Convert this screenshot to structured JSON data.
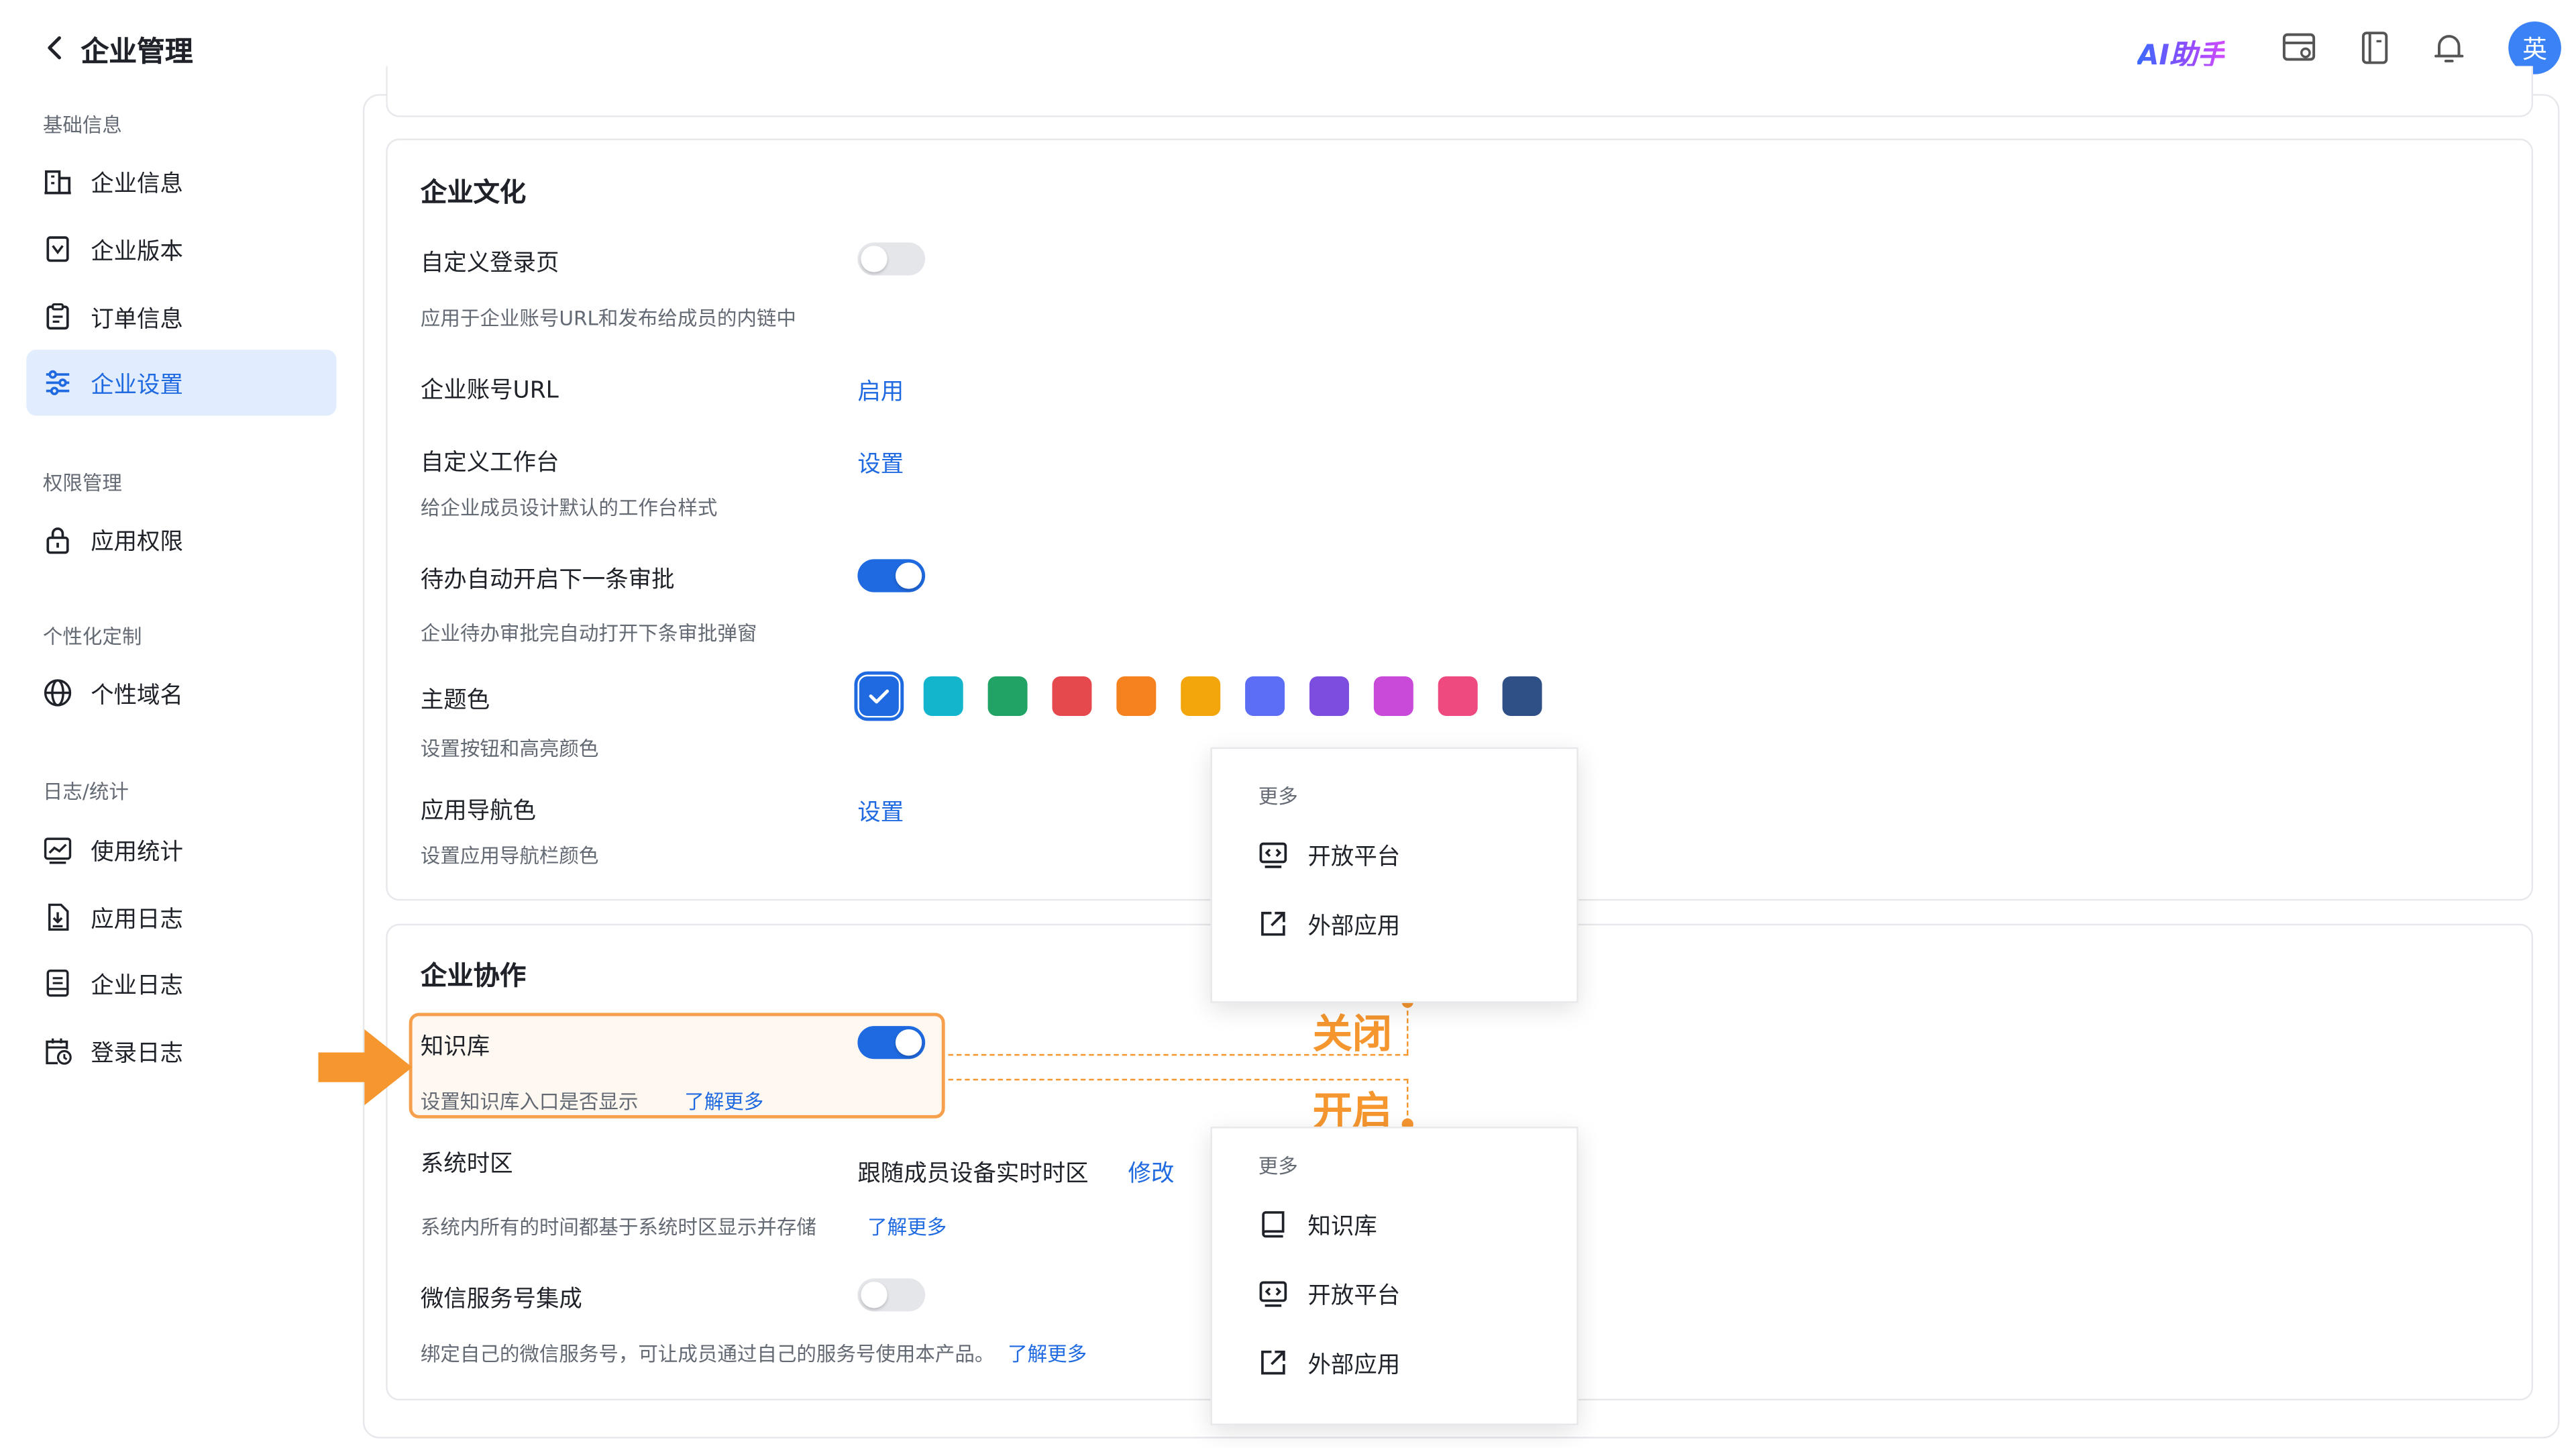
{
  "header": {
    "title": "企业管理",
    "ai_label": "AI助手",
    "avatar_text": "英",
    "icons": [
      "back-icon",
      "card-settings-icon",
      "book-icon",
      "bell-icon"
    ]
  },
  "sidebar": {
    "groups": [
      {
        "title": "基础信息",
        "items": [
          {
            "label": "企业信息",
            "icon": "building-icon"
          },
          {
            "label": "企业版本",
            "icon": "version-icon"
          },
          {
            "label": "订单信息",
            "icon": "clipboard-icon"
          },
          {
            "label": "企业设置",
            "icon": "sliders-icon",
            "active": true
          }
        ]
      },
      {
        "title": "权限管理",
        "items": [
          {
            "label": "应用权限",
            "icon": "lock-icon"
          }
        ]
      },
      {
        "title": "个性化定制",
        "items": [
          {
            "label": "个性域名",
            "icon": "globe-icon"
          }
        ]
      },
      {
        "title": "日志/统计",
        "items": [
          {
            "label": "使用统计",
            "icon": "chart-icon"
          },
          {
            "label": "应用日志",
            "icon": "app-log-icon"
          },
          {
            "label": "企业日志",
            "icon": "document-icon"
          },
          {
            "label": "登录日志",
            "icon": "calendar-clock-icon"
          }
        ]
      }
    ]
  },
  "culture": {
    "title": "企业文化",
    "custom_login": {
      "label": "自定义登录页",
      "desc": "应用于企业账号URL和发布给成员的内链中",
      "enabled": false
    },
    "account_url": {
      "label": "企业账号URL",
      "action": "启用"
    },
    "custom_workbench": {
      "label": "自定义工作台",
      "action": "设置",
      "desc": "给企业成员设计默认的工作台样式"
    },
    "auto_next_approval": {
      "label": "待办自动开启下一条审批",
      "desc": "企业待办审批完自动打开下条审批弹窗",
      "enabled": true
    },
    "theme_color": {
      "label": "主题色",
      "desc": "设置按钮和高亮颜色",
      "selected_index": 0,
      "colors": [
        "#1f6ae0",
        "#12b5cb",
        "#21a366",
        "#e5484d",
        "#f5811f",
        "#f2a60c",
        "#5b6ef5",
        "#7c4ddf",
        "#c94ad9",
        "#ef4a7f",
        "#2f4f87"
      ]
    },
    "app_nav_color": {
      "label": "应用导航色",
      "action": "设置",
      "desc": "设置应用导航栏颜色"
    }
  },
  "collab": {
    "title": "企业协作",
    "knowledge_base": {
      "label": "知识库",
      "desc": "设置知识库入口是否显示",
      "link": "了解更多",
      "enabled": true
    },
    "timezone": {
      "label": "系统时区",
      "value": "跟随成员设备实时时区",
      "action": "修改",
      "desc": "系统内所有的时间都基于系统时区显示并存储",
      "link": "了解更多"
    },
    "wechat_service": {
      "label": "微信服务号集成",
      "desc": "绑定自己的微信服务号，可让成员通过自己的服务号使用本产品。",
      "link": "了解更多",
      "enabled": false
    }
  },
  "popup_closed": {
    "header": "更多",
    "items": [
      {
        "label": "开放平台",
        "icon": "open-platform-icon"
      },
      {
        "label": "外部应用",
        "icon": "external-link-icon"
      }
    ]
  },
  "popup_open": {
    "header": "更多",
    "items": [
      {
        "label": "知识库",
        "icon": "knowledge-book-icon"
      },
      {
        "label": "开放平台",
        "icon": "open-platform-icon"
      },
      {
        "label": "外部应用",
        "icon": "external-link-icon"
      }
    ]
  },
  "annotations": {
    "closed": "关闭",
    "open": "开启",
    "accent_color": "#f5962f"
  }
}
